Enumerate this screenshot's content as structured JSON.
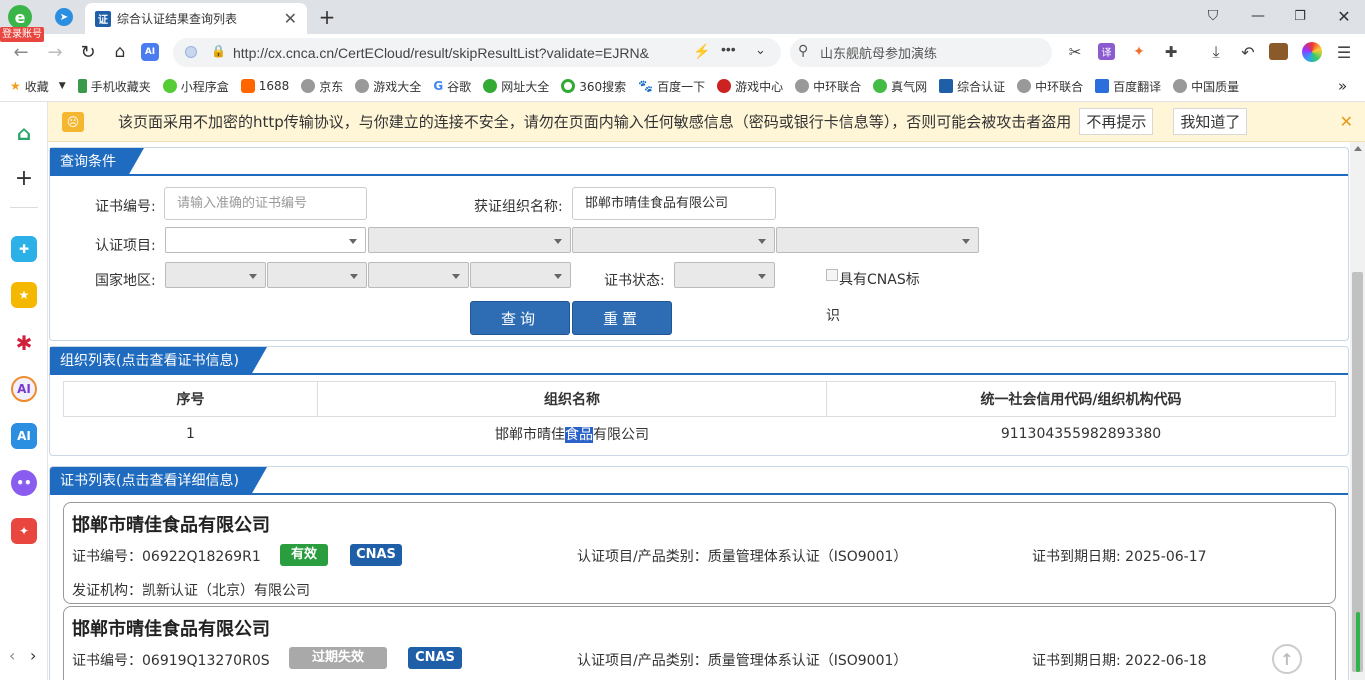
{
  "browser": {
    "login_badge": "登录账号",
    "tab_title": "综合认证结果查询列表",
    "tab_favicon": "证",
    "url": "http://cx.cnca.cn/CertECloud/result/skipResultList?validate=EJRN&",
    "search_text": "山东舰航母参加演练"
  },
  "bookmarks": [
    "收藏",
    "手机收藏夹",
    "小程序盒",
    "1688",
    "京东",
    "游戏大全",
    "谷歌",
    "网址大全",
    "360搜索",
    "百度一下",
    "游戏中心",
    "中环联合",
    "真气网",
    "综合认证",
    "中环联合",
    "百度翻译",
    "中国质量"
  ],
  "warning": {
    "text": "该页面采用不加密的http传输协议，与你建立的连接不安全，请勿在页面内输入任何敏感信息（密码或银行卡信息等），否则可能会被攻击者盗用",
    "btn_dismiss": "不再提示",
    "btn_ok": "我知道了"
  },
  "query": {
    "title": "查询条件",
    "cert_no_label": "证书编号:",
    "cert_no_placeholder": "请输入准确的证书编号",
    "org_label": "获证组织名称:",
    "org_value": "邯郸市晴佳食品有限公司",
    "project_label": "认证项目:",
    "region_label": "国家地区:",
    "status_label": "证书状态:",
    "cnas_label": "具有CNAS标",
    "cnas_label2": "识",
    "btn_query": "查询",
    "btn_reset": "重置"
  },
  "orgs": {
    "title": "组织列表(点击查看证书信息)",
    "headers": [
      "序号",
      "组织名称",
      "统一社会信用代码/组织机构代码"
    ],
    "rows": [
      {
        "no": "1",
        "name_pre": "邯郸市晴佳",
        "name_hl": "食品",
        "name_post": "有限公司",
        "code": "911304355982893380"
      }
    ]
  },
  "certs": {
    "title": "证书列表(点击查看详细信息)",
    "items": [
      {
        "org": "邯郸市晴佳食品有限公司",
        "cert_no": "证书编号：06922Q18269R1",
        "status": "有效",
        "cnas": "CNAS",
        "project": "认证项目/产品类别：质量管理体系认证（ISO9001）",
        "expiry": "证书到期日期: 2025-06-17",
        "issuer": "发证机构：凯新认证（北京）有限公司"
      },
      {
        "org": "邯郸市晴佳食品有限公司",
        "cert_no": "证书编号：06919Q13270R0S",
        "status": "过期失效",
        "cnas": "CNAS",
        "project": "认证项目/产品类别：质量管理体系认证（ISO9001）",
        "expiry": "证书到期日期: 2022-06-18"
      }
    ]
  },
  "colors": {
    "accent": "#1f6bbf",
    "valid": "#2a9d3f",
    "expired": "#a9a9a9",
    "cnas": "#1f5fa8"
  }
}
